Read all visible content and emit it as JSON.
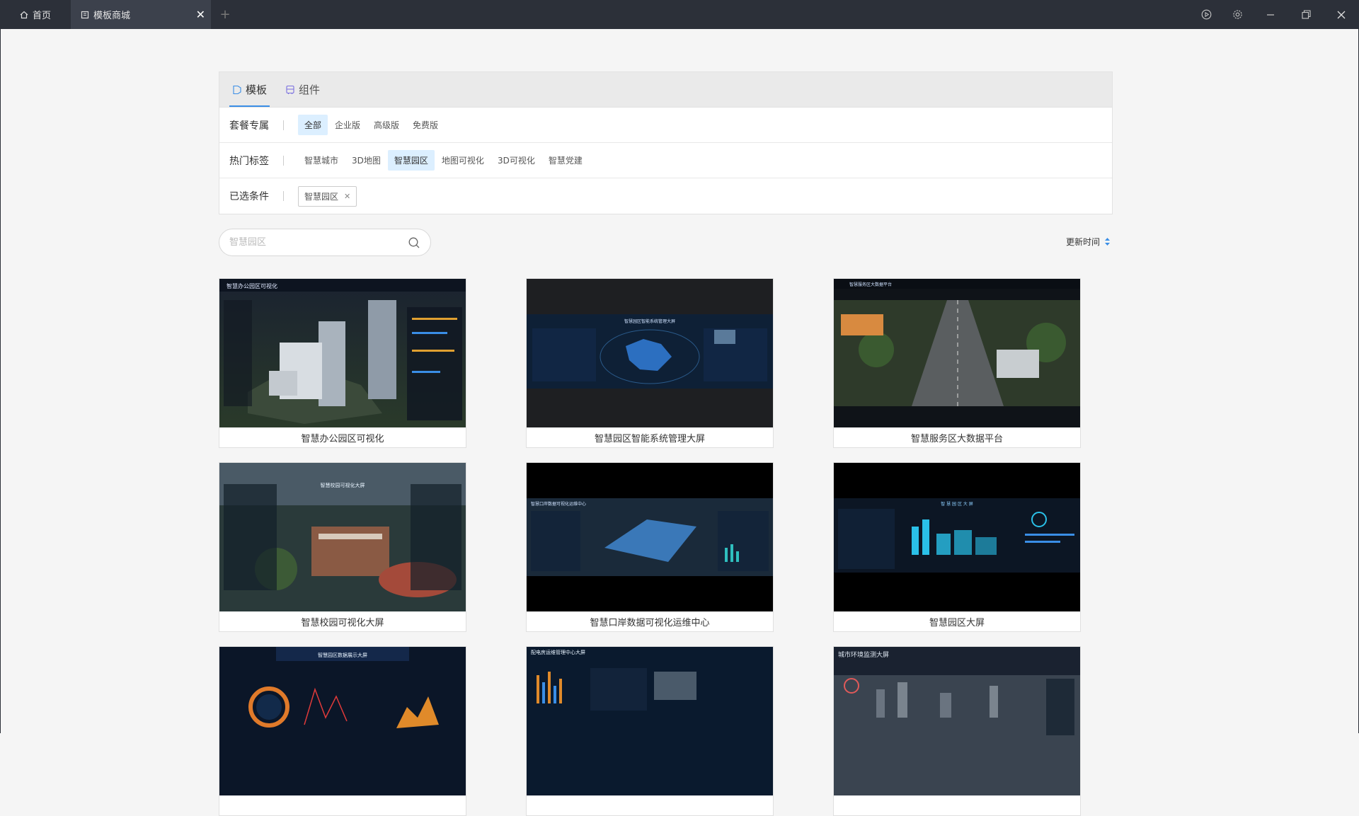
{
  "titlebar": {
    "home_tab": "首页",
    "active_tab": "模板商城",
    "close_glyph": "✕",
    "add_glyph": "+"
  },
  "panel": {
    "tabs": [
      {
        "label": "模板",
        "icon": "tag-icon"
      },
      {
        "label": "组件",
        "icon": "component-icon"
      }
    ],
    "package": {
      "label": "套餐专属",
      "options": [
        "全部",
        "企业版",
        "高级版",
        "免费版"
      ],
      "selected": "全部"
    },
    "hot_tags": {
      "label": "热门标签",
      "options": [
        "智慧城市",
        "3D地图",
        "智慧园区",
        "地图可视化",
        "3D可视化",
        "智慧党建"
      ],
      "selected": "智慧园区"
    },
    "selected_conditions": {
      "label": "已选条件",
      "tags": [
        "智慧园区"
      ]
    }
  },
  "search": {
    "value": "",
    "placeholder": "智慧园区"
  },
  "sort": {
    "label": "更新时间"
  },
  "cards": [
    {
      "title": "智慧办公园区可视化",
      "thumb_title": "智慧办公园区可视化"
    },
    {
      "title": "智慧园区智能系统管理大屏",
      "thumb_title": "智慧园区智能系统管理大屏"
    },
    {
      "title": "智慧服务区大数据平台",
      "thumb_title": "智慧服务区大数据平台"
    },
    {
      "title": "智慧校园可视化大屏",
      "thumb_title": "智慧校园可视化大屏"
    },
    {
      "title": "智慧口岸数据可视化运维中心",
      "thumb_title": "智慧口岸数据可视化运维中心"
    },
    {
      "title": "智慧园区大屏",
      "thumb_title": "智 慧 园 区 大 屏"
    },
    {
      "title": "",
      "thumb_title": "智慧园区数据展示大屏"
    },
    {
      "title": "",
      "thumb_title": "配电房运维管理中心大屏"
    },
    {
      "title": "",
      "thumb_title": "城市环境监测大屏"
    }
  ],
  "colors": {
    "titlebar_bg": "#2c3039",
    "accent": "#3a8ee6",
    "chip_selected_bg": "#dcefff"
  }
}
